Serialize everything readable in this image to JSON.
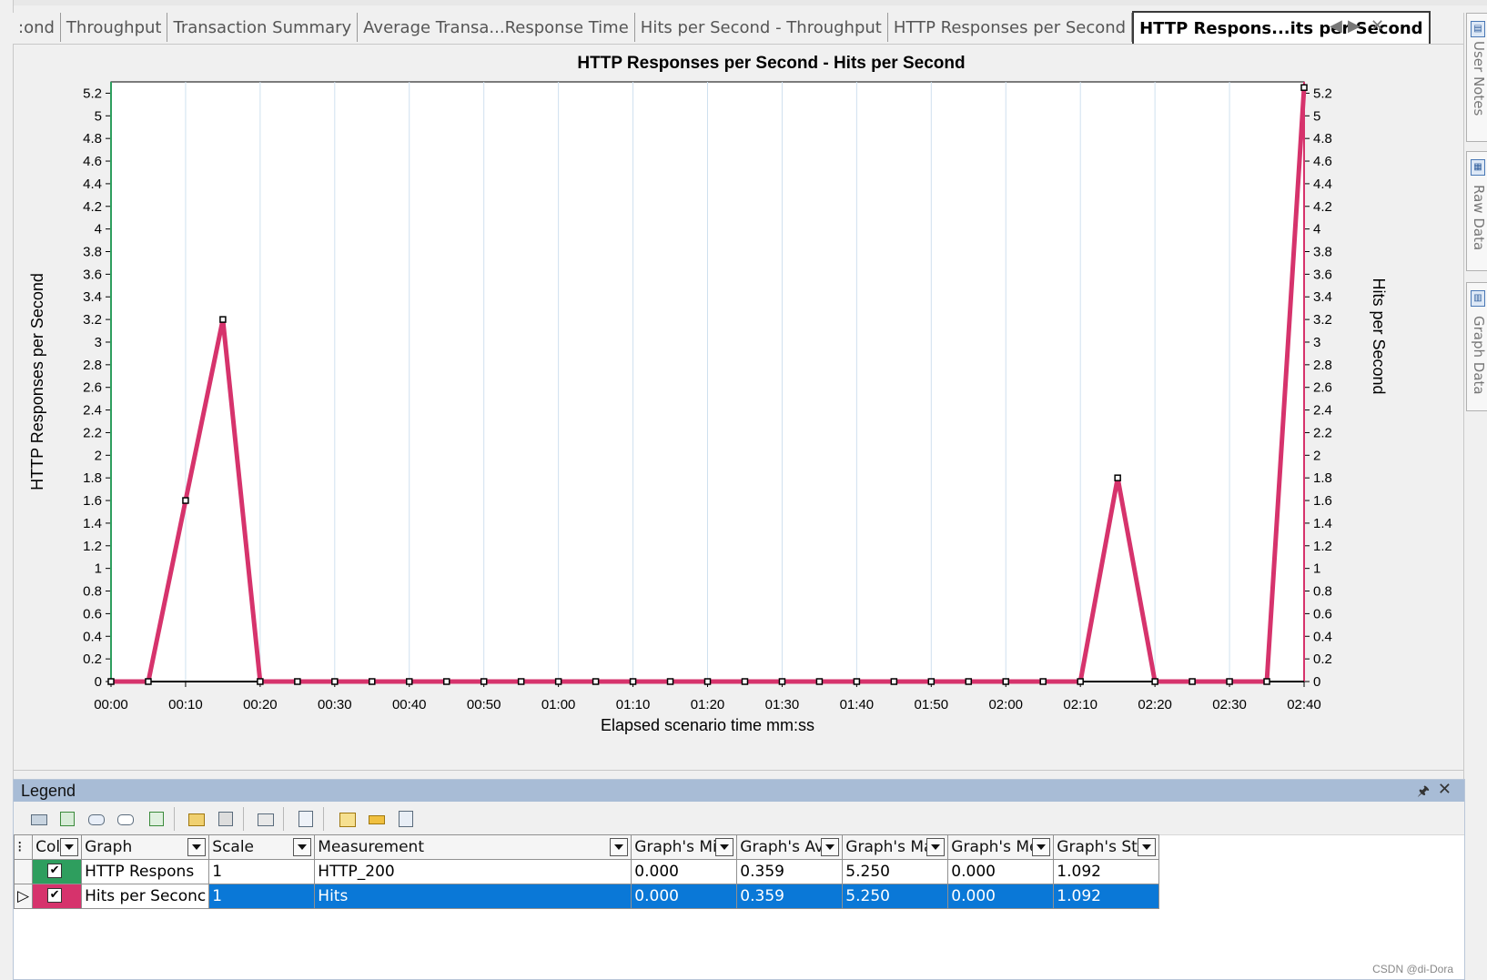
{
  "tabs": [
    {
      "label": ":ond",
      "active": false
    },
    {
      "label": "Throughput",
      "active": false
    },
    {
      "label": "Transaction Summary",
      "active": false
    },
    {
      "label": "Average Transa...Response Time",
      "active": false
    },
    {
      "label": "Hits per Second - Throughput",
      "active": false
    },
    {
      "label": "HTTP Responses per Second",
      "active": false
    },
    {
      "label": "HTTP Respons...its per Second",
      "active": true
    }
  ],
  "tab_controls": {
    "prev": "◀",
    "next": "▶",
    "close": "✕"
  },
  "side_panel": {
    "items": [
      {
        "label": "User Notes"
      },
      {
        "label": "Raw Data"
      },
      {
        "label": "Graph Data"
      }
    ]
  },
  "chart_data": {
    "type": "line",
    "title": "HTTP Responses per Second - Hits per Second",
    "xlabel": "Elapsed scenario time mm:ss",
    "ylabel": "HTTP Responses per Second",
    "y2label": "Hits per Second",
    "x_tick_labels": [
      "00:00",
      "00:10",
      "00:20",
      "00:30",
      "00:40",
      "00:50",
      "01:00",
      "01:10",
      "01:20",
      "01:30",
      "01:40",
      "01:50",
      "02:00",
      "02:10",
      "02:20",
      "02:30",
      "02:40"
    ],
    "y_tick_labels": [
      "0",
      "0.2",
      "0.4",
      "0.6",
      "0.8",
      "1",
      "1.2",
      "1.4",
      "1.6",
      "1.8",
      "2",
      "2.2",
      "2.4",
      "2.6",
      "2.8",
      "3",
      "3.2",
      "3.4",
      "3.6",
      "3.8",
      "4",
      "4.2",
      "4.4",
      "4.6",
      "4.8",
      "5",
      "5.2"
    ],
    "xlim": [
      0,
      160
    ],
    "ylim": [
      0,
      5.3
    ],
    "grid": true,
    "series": [
      {
        "name": "HTTP Respons",
        "color": "#2e9e5e",
        "axis": "left",
        "x": [
          0,
          5,
          10,
          15,
          20,
          25,
          30,
          35,
          40,
          45,
          50,
          55,
          60,
          65,
          70,
          75,
          80,
          85,
          90,
          95,
          100,
          105,
          110,
          115,
          120,
          125,
          130,
          135,
          140,
          145,
          150,
          155,
          160
        ],
        "y": [
          0,
          0,
          1.6,
          3.2,
          0,
          0,
          0,
          0,
          0,
          0,
          0,
          0,
          0,
          0,
          0,
          0,
          0,
          0,
          0,
          0,
          0,
          0,
          0,
          0,
          0,
          0,
          0,
          1.8,
          0,
          0,
          0,
          0,
          5.25
        ]
      },
      {
        "name": "Hits per Seconc",
        "color": "#d6336c",
        "axis": "right",
        "x": [
          0,
          5,
          10,
          15,
          20,
          25,
          30,
          35,
          40,
          45,
          50,
          55,
          60,
          65,
          70,
          75,
          80,
          85,
          90,
          95,
          100,
          105,
          110,
          115,
          120,
          125,
          130,
          135,
          140,
          145,
          150,
          155,
          160
        ],
        "y": [
          0,
          0,
          1.6,
          3.2,
          0,
          0,
          0,
          0,
          0,
          0,
          0,
          0,
          0,
          0,
          0,
          0,
          0,
          0,
          0,
          0,
          0,
          0,
          0,
          0,
          0,
          0,
          0,
          1.8,
          0,
          0,
          0,
          0,
          5.25
        ]
      }
    ]
  },
  "legend": {
    "title": "Legend",
    "pin": "🖈",
    "close": "✕",
    "columns": [
      "Col",
      "Graph",
      "Scale",
      "Measurement",
      "Graph's Mini",
      "Graph's Ave",
      "Graph's Ma",
      "Graph's Mec",
      "Graph's Std."
    ],
    "rows": [
      {
        "color": "#2e9e5e",
        "checked": "✔",
        "graph": "HTTP Respons",
        "scale": "1",
        "measurement": "HTTP_200",
        "min": "0.000",
        "avg": "0.359",
        "max": "5.250",
        "median": "0.000",
        "std": "1.092",
        "selected": false
      },
      {
        "color": "#d6336c",
        "checked": "✔",
        "graph": "Hits per Seconc",
        "scale": "1",
        "measurement": "Hits",
        "min": "0.000",
        "avg": "0.359",
        "max": "5.250",
        "median": "0.000",
        "std": "1.092",
        "selected": true
      }
    ]
  },
  "watermark": "CSDN @di-Dora"
}
